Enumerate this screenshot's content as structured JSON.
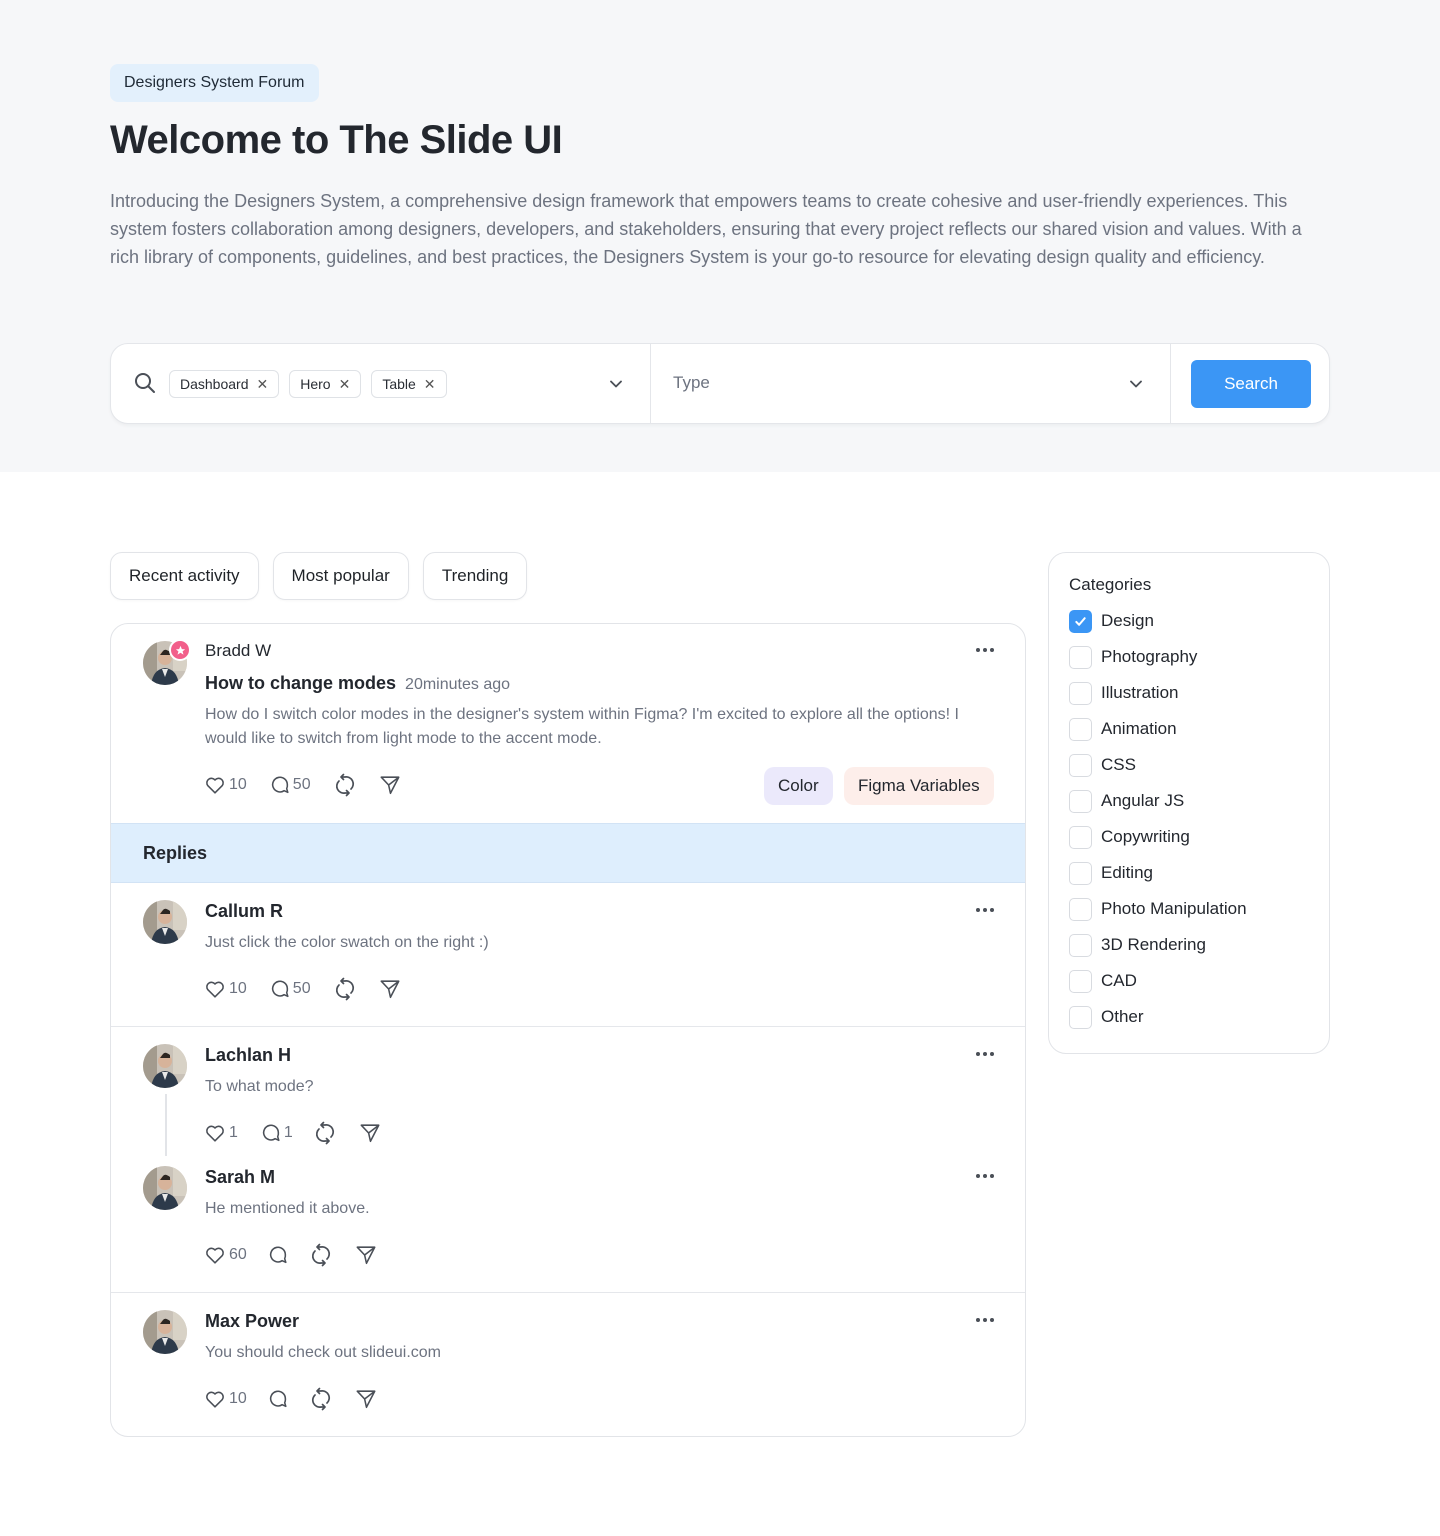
{
  "header": {
    "badge": "Designers System Forum",
    "title": "Welcome to The Slide UI",
    "intro": "Introducing the Designers System, a comprehensive design framework that empowers teams to create cohesive and user-friendly experiences. This system fosters collaboration among designers, developers, and stakeholders, ensuring that every project reflects our shared vision and values. With a rich library of components, guidelines, and best practices, the Designers System is your go-to resource for elevating design quality and efficiency."
  },
  "search": {
    "chips": [
      "Dashboard",
      "Hero",
      "Table"
    ],
    "type_placeholder": "Type",
    "button_label": "Search"
  },
  "filters": [
    "Recent activity",
    "Most popular",
    "Trending"
  ],
  "post": {
    "author": "Bradd W",
    "title": "How to change modes",
    "time": "20minutes ago",
    "body": "How do I switch color modes in the designer's system within Figma? I'm excited to explore all the options! I would like to switch from light mode to the accent mode.",
    "likes": "10",
    "comments": "50",
    "tags": [
      "Color",
      "Figma Variables"
    ]
  },
  "replies_label": "Replies",
  "replies": [
    {
      "author": "Callum R",
      "body": "Just click the color swatch on the right :)",
      "likes": "10",
      "comments": "50"
    },
    {
      "author": "Lachlan H",
      "body": "To what mode?",
      "likes": "1",
      "comments": "1"
    },
    {
      "author": "Sarah M",
      "body": "He mentioned it above.",
      "likes": "60",
      "comments": ""
    },
    {
      "author": "Max Power",
      "body": "You should check out slideui.com",
      "likes": "10",
      "comments": ""
    }
  ],
  "categories": {
    "title": "Categories",
    "items": [
      {
        "label": "Design",
        "checked": true
      },
      {
        "label": "Photography",
        "checked": false
      },
      {
        "label": "Illustration",
        "checked": false
      },
      {
        "label": "Animation",
        "checked": false
      },
      {
        "label": "CSS",
        "checked": false
      },
      {
        "label": "Angular JS",
        "checked": false
      },
      {
        "label": "Copywriting",
        "checked": false
      },
      {
        "label": "Editing",
        "checked": false
      },
      {
        "label": "Photo Manipulation",
        "checked": false
      },
      {
        "label": "3D Rendering",
        "checked": false
      },
      {
        "label": "CAD",
        "checked": false
      },
      {
        "label": "Other",
        "checked": false
      }
    ]
  },
  "colors": {
    "accent": "#3b96f5",
    "replies_bg": "#deeefd",
    "tag_color_bg": "#ebe9fb",
    "tag_figma_bg": "#fdeeea",
    "star_badge": "#f25f8a"
  }
}
